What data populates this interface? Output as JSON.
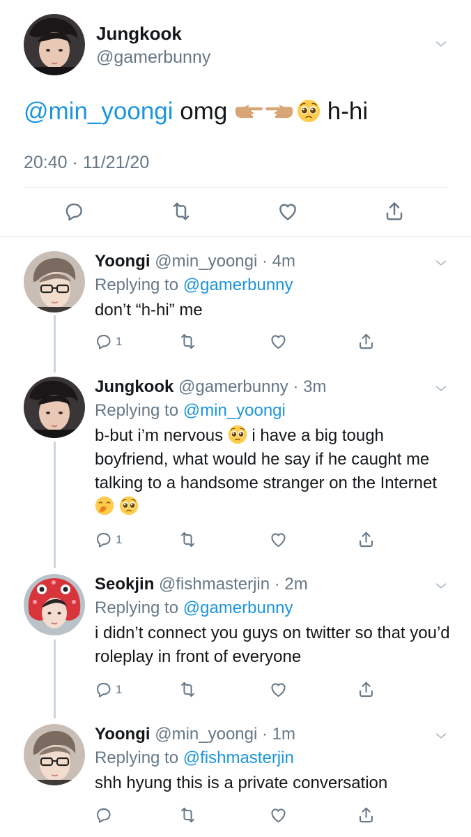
{
  "main_tweet": {
    "name": "Jungkook",
    "handle": "@gamerbunny",
    "mention": "@min_yoongi",
    "text": " omg ",
    "text_after": " h-hi",
    "timestamp": "20:40 · 11/21/20",
    "emojis": [
      "backhand-index-right-icon",
      "backhand-index-left-icon",
      "pleading-face-icon"
    ]
  },
  "replies": [
    {
      "name": "Yoongi",
      "handle_time": " @min_yoongi · 4m",
      "replying_prefix": "Replying to ",
      "replying_to": "@gamerbunny",
      "text": "don’t “h-hi” me",
      "reply_count": "1"
    },
    {
      "name": "Jungkook",
      "handle_time": " @gamerbunny · 3m",
      "replying_prefix": "Replying to ",
      "replying_to": "@min_yoongi",
      "text_part1": "b-but i’m nervous ",
      "text_part2": " i have a big tough boyfriend, what would he say if he caught me talking to a handsome stranger on the Internet ",
      "reply_count": "1",
      "emojis": [
        "pleading-face-icon",
        "face-with-hand-over-mouth-icon",
        "pleading-face-icon"
      ]
    },
    {
      "name": "Seokjin",
      "handle_time": " @fishmasterjin · 2m",
      "replying_prefix": "Replying to ",
      "replying_to": "@gamerbunny",
      "text": "i didn’t connect you guys on twitter so that you’d roleplay in front of everyone",
      "reply_count": "1"
    },
    {
      "name": "Yoongi",
      "handle_time": " @min_yoongi · 1m",
      "replying_prefix": "Replying to ",
      "replying_to": "@fishmasterjin",
      "text": "shh hyung this is a private conversation",
      "reply_count": ""
    }
  ],
  "colors": {
    "link": "#1b95e0",
    "secondary_text": "#657786",
    "divider": "#e1e8ed",
    "thread_line": "#ccd6dd"
  }
}
